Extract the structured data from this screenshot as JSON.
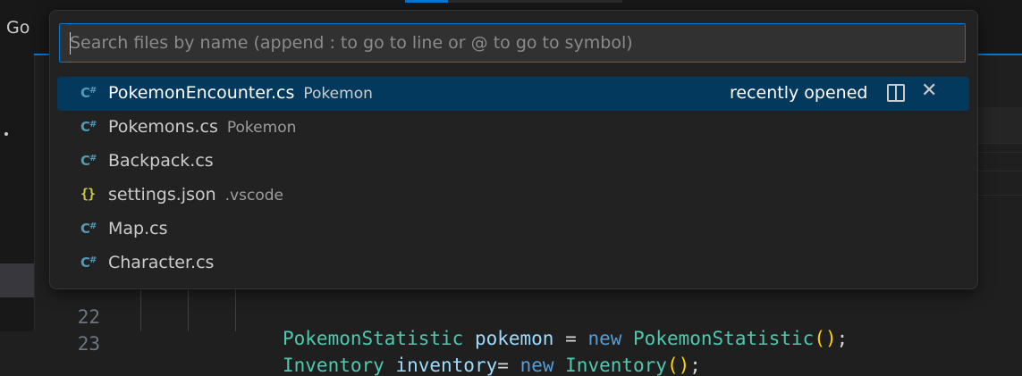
{
  "menubar": {
    "go_label": "Go"
  },
  "quick_open": {
    "search": {
      "value": "",
      "placeholder": "Search files by name (append : to go to line or @ to go to symbol)"
    },
    "results": [
      {
        "icon": "csharp-file-icon",
        "name": "PokemonEncounter.cs",
        "description": "Pokemon",
        "meta": "recently opened",
        "selected": true
      },
      {
        "icon": "csharp-file-icon",
        "name": "Pokemons.cs",
        "description": "Pokemon"
      },
      {
        "icon": "csharp-file-icon",
        "name": "Backpack.cs",
        "description": ""
      },
      {
        "icon": "json-file-icon",
        "name": "settings.json",
        "description": ".vscode"
      },
      {
        "icon": "csharp-file-icon",
        "name": "Map.cs",
        "description": ""
      },
      {
        "icon": "csharp-file-icon",
        "name": "Character.cs",
        "description": ""
      }
    ],
    "icon_glyphs": {
      "csharp": "C",
      "csharp_hash": "#",
      "json": "{}",
      "close": "✕"
    }
  },
  "editor": {
    "lines": [
      {
        "number": "22",
        "tokens": {
          "type1": "PokemonStatistic",
          "var": "pokemon",
          "op": "=",
          "kw": "new",
          "type2": "PokemonStatistic",
          "paren": "()",
          "semi": ";"
        }
      },
      {
        "number": "23",
        "tokens": {
          "type1": "Inventory",
          "var": "inventory",
          "op": "=",
          "kw": "new",
          "type2": "Inventory",
          "paren": "()",
          "semi": ";"
        }
      }
    ]
  },
  "colors": {
    "accent": "#0078d4",
    "selection": "#04395e",
    "csharp_icon": "#519aba",
    "json_icon": "#cbcb41"
  }
}
